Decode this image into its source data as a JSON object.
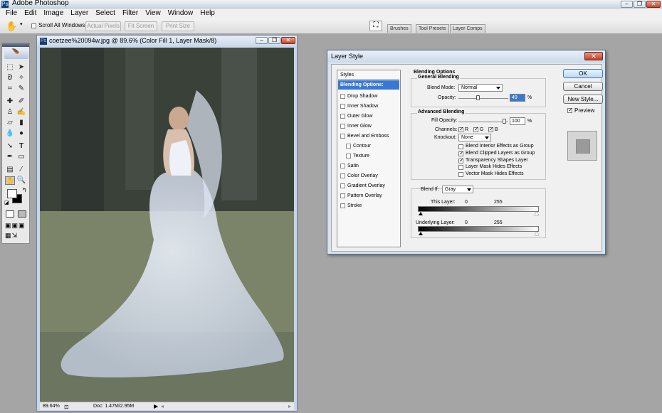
{
  "app": {
    "title": "Adobe Photoshop"
  },
  "menu": [
    "File",
    "Edit",
    "Image",
    "Layer",
    "Select",
    "Filter",
    "View",
    "Window",
    "Help"
  ],
  "options_bar": {
    "scroll_all_windows": "Scroll All Windows",
    "actual_pixels": "Actual Pixels",
    "fit_screen": "Fit Screen",
    "print_size": "Print Size",
    "tabs": [
      "Brushes",
      "Tool Presets",
      "Layer Comps"
    ]
  },
  "document": {
    "title": "coetzee%20094w.jpg @ 89.6% (Color Fill 1, Layer Mask/8)",
    "zoom": "89.64%",
    "doc_info": "Doc: 1.47M/2.95M"
  },
  "dialog": {
    "title": "Layer Style",
    "styles_header": "Styles",
    "styles": [
      {
        "label": "Blending Options: Custom",
        "selected": true,
        "checkbox": false
      },
      {
        "label": "Drop Shadow",
        "checkbox": true
      },
      {
        "label": "Inner Shadow",
        "checkbox": true
      },
      {
        "label": "Outer Glow",
        "checkbox": true
      },
      {
        "label": "Inner Glow",
        "checkbox": true
      },
      {
        "label": "Bevel and Emboss",
        "checkbox": true
      },
      {
        "label": "Contour",
        "checkbox": true,
        "sub": true
      },
      {
        "label": "Texture",
        "checkbox": true,
        "sub": true
      },
      {
        "label": "Satin",
        "checkbox": true
      },
      {
        "label": "Color Overlay",
        "checkbox": true
      },
      {
        "label": "Gradient Overlay",
        "checkbox": true
      },
      {
        "label": "Pattern Overlay",
        "checkbox": true
      },
      {
        "label": "Stroke",
        "checkbox": true
      }
    ],
    "blending_options": "Blending Options",
    "general_blending": "General Blending",
    "blend_mode_label": "Blend Mode:",
    "blend_mode_value": "Normal",
    "opacity_label": "Opacity:",
    "opacity_value": "49",
    "opacity_unit": "%",
    "advanced_blending": "Advanced Blending",
    "fill_opacity_label": "Fill Opacity:",
    "fill_opacity_value": "100",
    "fill_opacity_unit": "%",
    "channels_label": "Channels:",
    "channels": [
      "R",
      "G",
      "B"
    ],
    "knockout_label": "Knockout:",
    "knockout_value": "None",
    "advanced_checks": [
      {
        "label": "Blend Interior Effects as Group",
        "checked": false
      },
      {
        "label": "Blend Clipped Layers as Group",
        "checked": true
      },
      {
        "label": "Transparency Shapes Layer",
        "checked": true
      },
      {
        "label": "Layer Mask Hides Effects",
        "checked": false
      },
      {
        "label": "Vector Mask Hides Effects",
        "checked": false
      }
    ],
    "blend_if_label": "Blend If:",
    "blend_if_value": "Gray",
    "this_layer_label": "This Layer:",
    "this_layer_low": "0",
    "this_layer_high": "255",
    "underlying_layer_label": "Underlying Layer:",
    "underlying_low": "0",
    "underlying_high": "255",
    "ok": "OK",
    "cancel": "Cancel",
    "new_style": "New Style...",
    "preview_label": "Preview"
  },
  "colors": {
    "selection_blue": "#3a79d3",
    "dialog_frame": "#d8e4f0",
    "workspace_gray": "#a5a5a5"
  }
}
